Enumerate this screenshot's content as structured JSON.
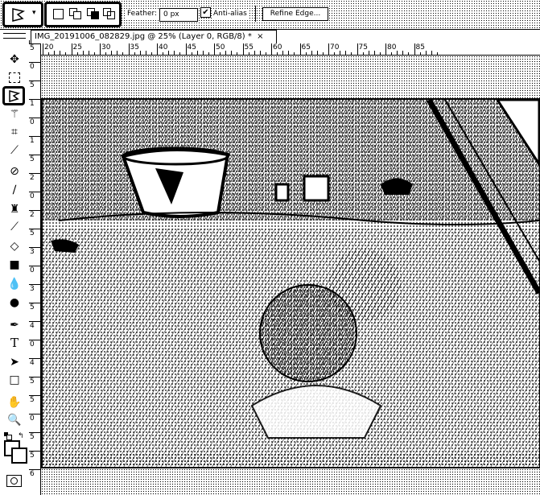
{
  "options_bar": {
    "feather_label": "Feather:",
    "feather_value": "0 px",
    "antialias_label": "Anti-alias",
    "antialias_checked": true,
    "refine_edge_label": "Refine Edge..."
  },
  "document_tab": {
    "title": "IMG_20191006_082829.jpg @ 25% (Layer 0, RGB/8) *",
    "close": "×"
  },
  "ruler": {
    "h_labels": [
      "20",
      "25",
      "30",
      "35",
      "40",
      "45",
      "50",
      "55",
      "60",
      "65",
      "70",
      "75",
      "80",
      "85"
    ],
    "v_labels": [
      "5",
      "0",
      "5",
      "1",
      "0",
      "1",
      "5",
      "2",
      "0",
      "2",
      "5",
      "3",
      "0",
      "3",
      "5",
      "4",
      "0",
      "4",
      "5",
      "5",
      "0",
      "5",
      "5",
      "6"
    ]
  },
  "toolbox": {
    "tools": [
      "move-tool",
      "marquee-tool",
      "polygonal-lasso-tool",
      "magic-wand-tool",
      "crop-tool",
      "eyedropper-tool",
      "healing-brush-tool",
      "brush-tool",
      "clone-stamp-tool",
      "history-brush-tool",
      "eraser-tool",
      "gradient-tool",
      "blur-tool",
      "dodge-tool",
      "pen-tool",
      "type-tool",
      "path-selection-tool",
      "rectangle-tool",
      "hand-tool",
      "zoom-tool"
    ]
  }
}
